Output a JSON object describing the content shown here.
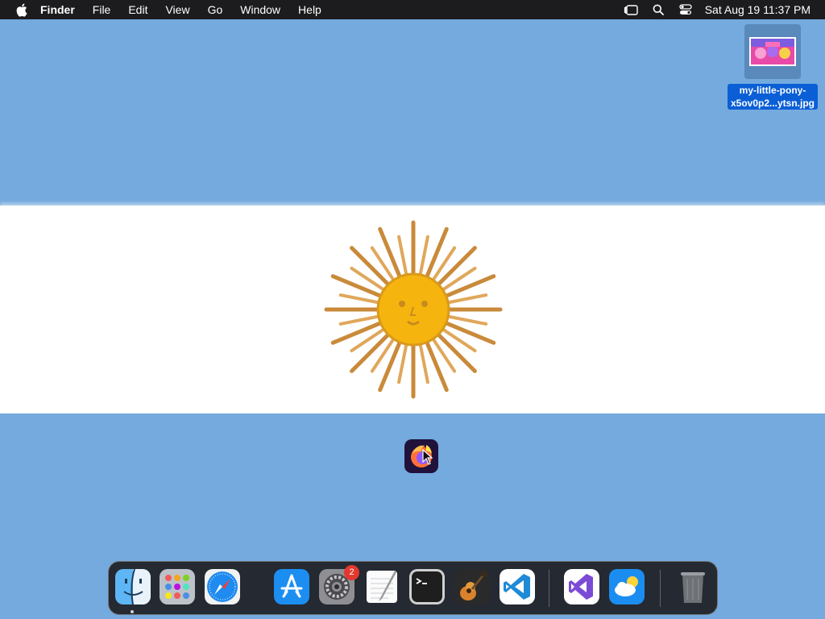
{
  "menubar": {
    "app_name": "Finder",
    "items": [
      "File",
      "Edit",
      "View",
      "Go",
      "Window",
      "Help"
    ],
    "clock": "Sat Aug 19  11:37 PM",
    "status_icons": [
      "stage-manager-icon",
      "spotlight-icon",
      "control-center-icon"
    ]
  },
  "desktop": {
    "wallpaper": "argentina-flag",
    "colors": {
      "sky_blue": "#74aade",
      "white": "#ffffff",
      "sun_gold": "#f6b40e",
      "sun_brown": "#c17a24"
    },
    "file": {
      "name_line1": "my-little-pony-",
      "name_line2": "x5ov0p2...ytsn.jpg",
      "selected": true
    },
    "dragged_app": "firefox-icon"
  },
  "dock": {
    "items": [
      {
        "name": "finder",
        "running": true
      },
      {
        "name": "launchpad"
      },
      {
        "name": "safari"
      },
      {
        "name": "app-store"
      },
      {
        "name": "system-settings",
        "badge": "2"
      },
      {
        "name": "textedit"
      },
      {
        "name": "terminal"
      },
      {
        "name": "garageband"
      },
      {
        "name": "visual-studio-code"
      },
      {
        "name": "visual-studio"
      },
      {
        "name": "weather"
      },
      {
        "name": "trash"
      }
    ]
  }
}
